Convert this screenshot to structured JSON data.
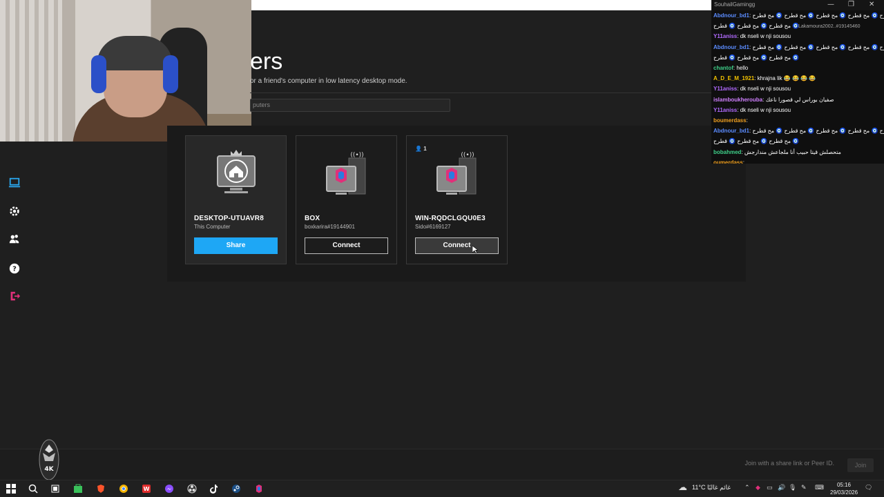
{
  "page": {
    "title": "ers",
    "subtitle": "or a friend's computer in low latency desktop mode.",
    "search_placeholder": "puters"
  },
  "computers": [
    {
      "name": "DESKTOP-UTUAVR8",
      "sub": "This Computer",
      "button": "Share"
    },
    {
      "name": "BOX",
      "sub": "boxkarira#19144901",
      "button": "Connect"
    },
    {
      "name": "WIN-RQDCLGQU0E3",
      "sub": "Sido#6169127",
      "button": "Connect",
      "users": "1"
    }
  ],
  "join": {
    "placeholder": "Join with a share link or Peer ID.",
    "button": "Join"
  },
  "chat": {
    "header": "SouhailGamingg",
    "tag": "Lakamoura2002..#19145460",
    "lines": [
      {
        "user": "Abdnour_bd1",
        "text": ": مح قطرح 🧿 مح قطرح 🧿 مح قطرح 🧿 مح قطرح 🧿 مح قطرح",
        "color": "#5b8cff"
      },
      {
        "user": "",
        "text": "مح قطرح 🧿 مح قطرح 🧿 قطرح 🧿",
        "color": "#ffffff"
      },
      {
        "user": "Y11aniss",
        "text": ": dk nseli w nji sousou",
        "color": "#b26bff"
      },
      {
        "user": "Abdnour_bd1",
        "text": ": مح قطرح 🧿 مح قطرح 🧿 مح قطرح 🧿 مح قطرح 🧿 مح قطرح",
        "color": "#5b8cff"
      },
      {
        "user": "",
        "text": "مح قطرح 🧿 مح قطرح 🧿 قطرح 🧿",
        "color": "#ffffff"
      },
      {
        "user": "chantof",
        "text": ": hello",
        "color": "#3fd18a"
      },
      {
        "user": "A_D_E_M_1921",
        "text": ": khrajna lik 😂 😂 😂 😂",
        "color": "#f0c000"
      },
      {
        "user": "Y11aniss",
        "text": ": dk nseli w nji sousou",
        "color": "#b26bff"
      },
      {
        "user": "islamboukherouba",
        "text": ": صفيان بوراس لي قصورا ناعك",
        "color": "#d080ff"
      },
      {
        "user": "Y11aniss",
        "text": ": dk nseli w nji sousou",
        "color": "#b26bff"
      },
      {
        "user": "boumerdass",
        "text": ":",
        "color": "#f0a020"
      },
      {
        "user": "Abdnour_bd1",
        "text": ": مح قطرح 🧿 مح قطرح 🧿 مح قطرح 🧿 مح قطرح 🧿 مح قطرح",
        "color": "#5b8cff"
      },
      {
        "user": "",
        "text": "مح قطرح 🧿 مح قطرح 🧿 قطرح 🧿",
        "color": "#ffffff"
      },
      {
        "user": "bobahmed",
        "text": ": متحصلش قيتا حبيب أنا ملجاعش مندارجش",
        "color": "#3fd18a"
      },
      {
        "user": "oumerdass",
        "text": ":",
        "color": "#f0a020"
      }
    ]
  },
  "taskbar": {
    "weather": "11°C غائم غالبًا",
    "time": "05:16",
    "date": "29/03/2026"
  },
  "badge": "4K",
  "colors": {
    "accent": "#1ea7f5",
    "brand": "#e0307a",
    "bg": "#1f1f1f"
  }
}
